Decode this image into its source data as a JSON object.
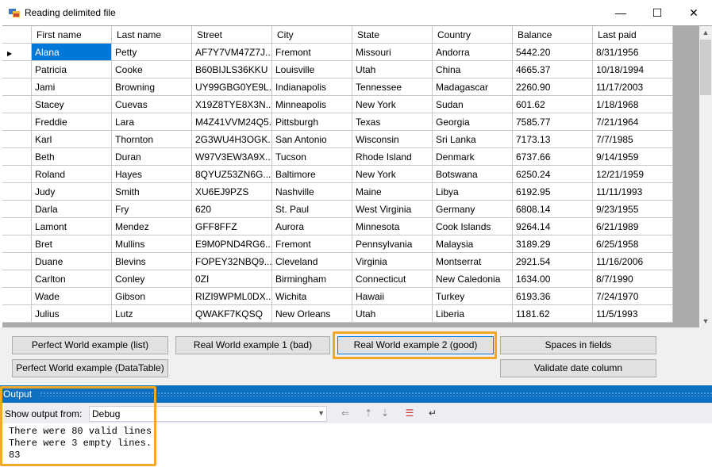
{
  "window": {
    "title": "Reading delimited file",
    "minimize_glyph": "—",
    "maximize_glyph": "☐",
    "close_glyph": "✕"
  },
  "grid": {
    "columns": [
      "First name",
      "Last name",
      "Street",
      "City",
      "State",
      "Country",
      "Balance",
      "Last paid"
    ],
    "rows": [
      [
        "Alana",
        "Petty",
        "AF7Y7VM47Z7J...",
        "Fremont",
        "Missouri",
        "Andorra",
        "5442.20",
        "8/31/1956"
      ],
      [
        "Patricia",
        "Cooke",
        "B60BIJLS36KKU",
        "Louisville",
        "Utah",
        "China",
        "4665.37",
        "10/18/1994"
      ],
      [
        "Jami",
        "Browning",
        "UY99GBG0YE9L...",
        "Indianapolis",
        "Tennessee",
        "Madagascar",
        "2260.90",
        "11/17/2003"
      ],
      [
        "Stacey",
        "Cuevas",
        "X19Z8TYE8X3N...",
        "Minneapolis",
        "New York",
        "Sudan",
        "601.62",
        "1/18/1968"
      ],
      [
        "Freddie",
        "Lara",
        "M4Z41VVM24Q5...",
        "Pittsburgh",
        "Texas",
        "Georgia",
        "7585.77",
        "7/21/1964"
      ],
      [
        "Karl",
        "Thornton",
        "2G3WU4H3OGK...",
        "San Antonio",
        "Wisconsin",
        "Sri Lanka",
        "7173.13",
        "7/7/1985"
      ],
      [
        "Beth",
        "Duran",
        "W97V3EW3A9X...",
        "Tucson",
        "Rhode Island",
        "Denmark",
        "6737.66",
        "9/14/1959"
      ],
      [
        "Roland",
        "Hayes",
        "8QYUZ53ZN6G...",
        "Baltimore",
        "New York",
        "Botswana",
        "6250.24",
        "12/21/1959"
      ],
      [
        "Judy",
        "Smith",
        "XU6EJ9PZS",
        "Nashville",
        "Maine",
        "Libya",
        "6192.95",
        "11/11/1993"
      ],
      [
        "Darla",
        "Fry",
        "620",
        "St. Paul",
        "West Virginia",
        "Germany",
        "6808.14",
        "9/23/1955"
      ],
      [
        "Lamont",
        "Mendez",
        "GFF8FFZ",
        "Aurora",
        "Minnesota",
        "Cook Islands",
        "9264.14",
        "6/21/1989"
      ],
      [
        "Bret",
        "Mullins",
        "E9M0PND4RG6...",
        "Fremont",
        "Pennsylvania",
        "Malaysia",
        "3189.29",
        "6/25/1958"
      ],
      [
        "Duane",
        "Blevins",
        "FOPEY32NBQ9...",
        "Cleveland",
        "Virginia",
        "Montserrat",
        "2921.54",
        "11/16/2006"
      ],
      [
        "Carlton",
        "Conley",
        "0ZI",
        "Birmingham",
        "Connecticut",
        "New Caledonia",
        "1634.00",
        "8/7/1990"
      ],
      [
        "Wade",
        "Gibson",
        "RIZI9WPML0DX...",
        "Wichita",
        "Hawaii",
        "Turkey",
        "6193.36",
        "7/24/1970"
      ],
      [
        "Julius",
        "Lutz",
        "QWAKF7KQSQ",
        "New Orleans",
        "Utah",
        "Liberia",
        "1181.62",
        "11/5/1993"
      ]
    ],
    "selected_row": 0
  },
  "buttons": {
    "perfect_list": "Perfect World example (list)",
    "real_bad": "Real World example 1 (bad)",
    "real_good": "Real World example 2 (good)",
    "spaces": "Spaces in fields",
    "perfect_datatable": "Perfect World example (DataTable)",
    "validate_date": "Validate date column"
  },
  "output": {
    "title": "Output",
    "show_output_from_label": "Show output from:",
    "source_selected": "Debug",
    "lines": [
      "There were 80 valid lines.",
      "There were 3 empty lines.",
      "83"
    ]
  },
  "colors": {
    "accent": "#0078d7",
    "highlight_box": "#f0a826",
    "output_title_bg": "#0e70c0"
  }
}
